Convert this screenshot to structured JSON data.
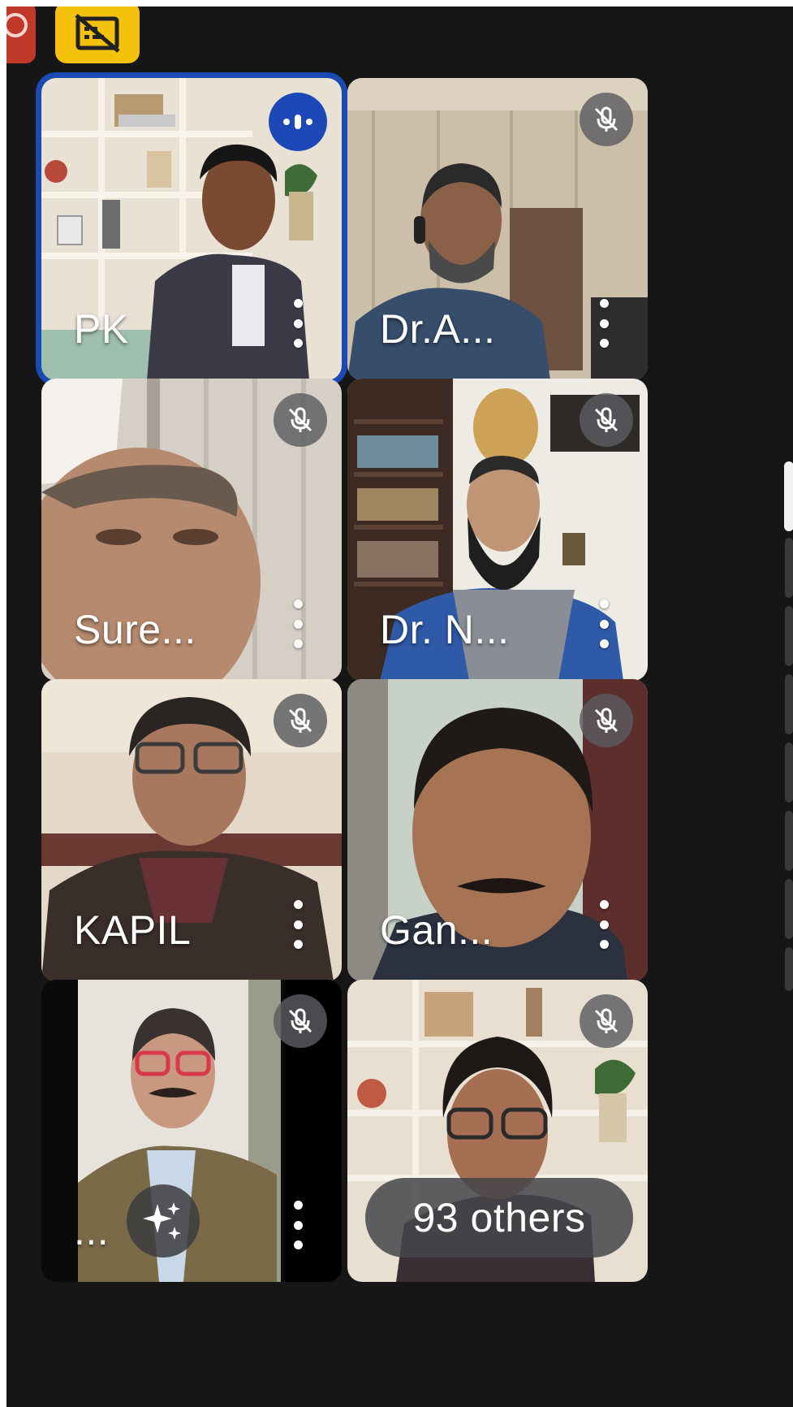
{
  "top_controls": {
    "record_icon": "record-icon",
    "captions_off_icon": "captions-off-icon",
    "accent_red": "#c0392b",
    "accent_yellow": "#f4c20d"
  },
  "participants": [
    {
      "name": "PK",
      "state": "speaking"
    },
    {
      "name": "Dr.A...",
      "state": "muted"
    },
    {
      "name": "Sure...",
      "state": "muted"
    },
    {
      "name": "Dr. N...",
      "state": "muted"
    },
    {
      "name": "KAPIL",
      "state": "muted"
    },
    {
      "name": "Gan...",
      "state": "muted"
    },
    {
      "name": "...",
      "state": "muted"
    },
    {
      "name": "",
      "state": "muted"
    }
  ],
  "overflow": {
    "label": "93 others"
  },
  "colors": {
    "speaking_border": "#1a4bb5",
    "mute_badge": "#5c5c60",
    "background": "#161616"
  }
}
